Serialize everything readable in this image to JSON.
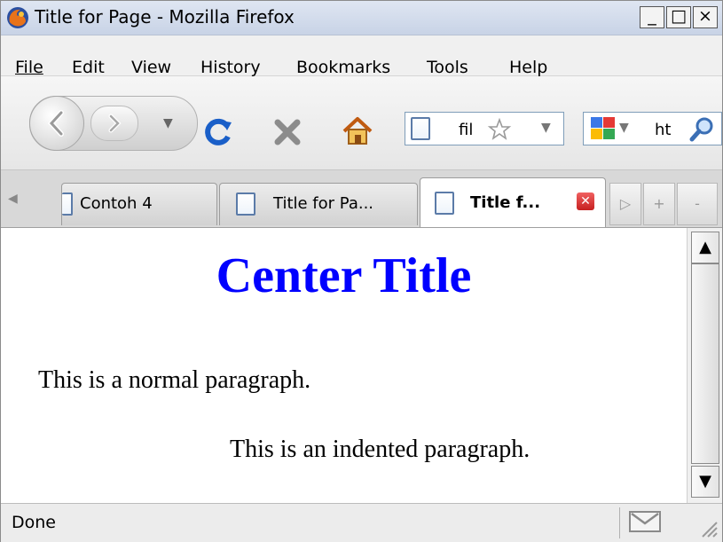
{
  "window": {
    "title": "Title for Page - Mozilla Firefox",
    "minimize_glyph": "_",
    "maximize_glyph": "□",
    "close_glyph": "×"
  },
  "menubar": {
    "items": [
      {
        "label": "File"
      },
      {
        "label": "Edit"
      },
      {
        "label": "View"
      },
      {
        "label": "History"
      },
      {
        "label": "Bookmarks"
      },
      {
        "label": "Tools"
      },
      {
        "label": "Help"
      }
    ]
  },
  "toolbar": {
    "url_text": "fil",
    "search_text": "ht",
    "icons": [
      "back-icon",
      "forward-icon",
      "history-dropdown-icon",
      "reload-icon",
      "stop-icon",
      "home-icon",
      "page-icon",
      "bookmark-star-icon",
      "google-icon",
      "search-icon"
    ]
  },
  "tabs": [
    {
      "label": "Contoh 4",
      "active": false
    },
    {
      "label": "Title for Pa...",
      "active": false
    },
    {
      "label": "Title f...",
      "active": true
    }
  ],
  "page": {
    "heading": "Center Title",
    "heading_color": "#0000ff",
    "paragraph_normal": "This is a normal paragraph.",
    "paragraph_indented": "This is an indented paragraph."
  },
  "status": {
    "text": "Done"
  }
}
